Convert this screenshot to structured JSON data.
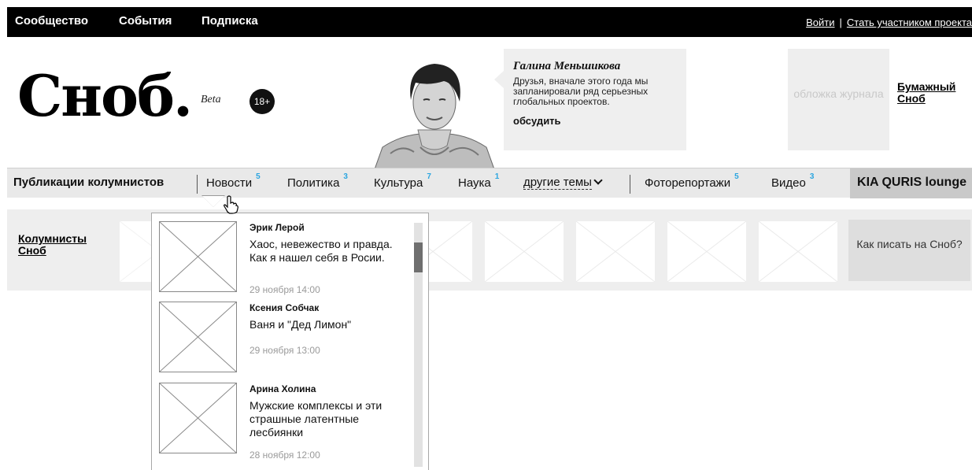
{
  "topbar": {
    "nav": [
      "Сообщество",
      "События",
      "Подписка"
    ],
    "login": "Войти",
    "separator": "|",
    "join": "Стать участником проекта"
  },
  "brand": {
    "logo": "Сноб.",
    "beta": "Beta",
    "age": "18+"
  },
  "featured": {
    "author": "Галина Меньшикова",
    "text": "Друзья, вначале этого года мы запланировали ряд серьезных глобальных проектов.",
    "action": "обсудить"
  },
  "magazine": {
    "cover_placeholder": "обложка журнала",
    "link": "Бумажный Сноб"
  },
  "categories": [
    {
      "label": "Публикации колумнистов",
      "badge": ""
    },
    {
      "label": "Новости",
      "badge": "5"
    },
    {
      "label": "Политика",
      "badge": "3"
    },
    {
      "label": "Культура",
      "badge": "7"
    },
    {
      "label": "Наука",
      "badge": "1"
    },
    {
      "label": "другие темы",
      "badge": ""
    },
    {
      "label": "Фоторепортажи",
      "badge": "5"
    },
    {
      "label": "Видео",
      "badge": "3"
    },
    {
      "label": "KIA QURIS lounge",
      "badge": ""
    }
  ],
  "columnists": {
    "title": "Колумнисты Сноб",
    "howto": "Как писать на Сноб?"
  },
  "news_dropdown": {
    "items": [
      {
        "author": "Эрик Лерой",
        "title": "Хаос, невежество и правда. Как я нашел себя в Росии.",
        "date": "29 ноября 14:00"
      },
      {
        "author": "Ксения Собчак",
        "title": "Ваня и \"Дед Лимон\"",
        "date": "29 ноября 13:00"
      },
      {
        "author": "Арина Холина",
        "title": "Мужские комплексы и эти страшные латентные лесбиянки",
        "date": "28 ноября 12:00"
      }
    ]
  },
  "colors": {
    "accent_badge": "#2aa5e0",
    "topbar": "#000000",
    "nav_bg": "#e9e9e9"
  }
}
